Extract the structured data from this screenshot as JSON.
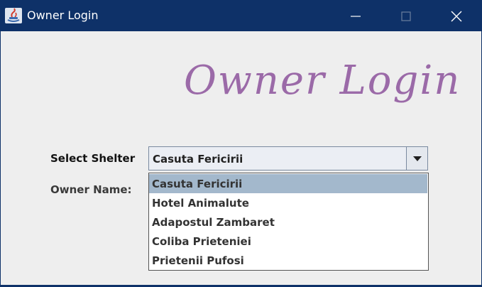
{
  "window": {
    "title": "Owner Login",
    "app_icon": "java-app-icon",
    "controls": {
      "minimize_icon": "minimize-icon",
      "maximize_icon": "maximize-icon",
      "close_icon": "close-icon"
    }
  },
  "form": {
    "heading": "Owner Login",
    "heading_color": "#9b6aa8",
    "shelter_label": "Select Shelter",
    "owner_label": "Owner Name:",
    "shelter_select": {
      "selected": "Casuta Fericirii",
      "options": [
        "Casuta Fericirii",
        "Hotel Animalute",
        "Adapostul Zambaret",
        "Coliba Prieteniei",
        "Prietenii Pufosi"
      ]
    }
  },
  "colors": {
    "titlebar": "#0e3168",
    "background": "#eeeeee",
    "selection": "#a3b8cc"
  }
}
